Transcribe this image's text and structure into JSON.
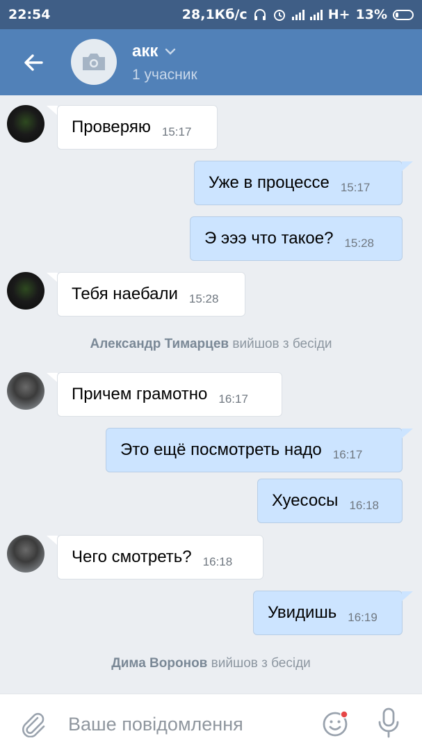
{
  "status_bar": {
    "time": "22:54",
    "net_speed": "28,1Кб/с",
    "network": "H+",
    "battery": "13%"
  },
  "header": {
    "title": "акк",
    "subtitle": "1 учасник"
  },
  "messages": [
    {
      "dir": "in",
      "avatar": "dark",
      "text": "Проверяю",
      "time": "15:17"
    },
    {
      "dir": "out",
      "text": "Уже в процессе",
      "time": "15:17"
    },
    {
      "dir": "out",
      "text": "Э эээ что такое?",
      "time": "15:28"
    },
    {
      "dir": "in",
      "avatar": "dark",
      "text": "Тебя наебали",
      "time": "15:28"
    },
    {
      "service": true,
      "name": "Александр Тимарцев",
      "action": "вийшов з бесіди"
    },
    {
      "dir": "in",
      "avatar": "gray",
      "text": "Причем грамотно",
      "time": "16:17"
    },
    {
      "dir": "out",
      "text": "Это ещё посмотреть надо",
      "time": "16:17"
    },
    {
      "dir": "out",
      "text": "Хуесосы",
      "time": "16:18"
    },
    {
      "dir": "in",
      "avatar": "gray",
      "text": "Чего смотреть?",
      "time": "16:18"
    },
    {
      "dir": "out",
      "text": "Увидишь",
      "time": "16:19"
    },
    {
      "service": true,
      "name": "Дима Воронов",
      "action": "вийшов з бесіди"
    }
  ],
  "input": {
    "placeholder": "Ваше повідомлення"
  },
  "colors": {
    "status_bar": "#3f5e86",
    "header": "#5181b8",
    "background": "#ebeef2",
    "incoming_bubble": "#ffffff",
    "outgoing_bubble": "#cce4ff",
    "notification_dot": "#e64646"
  },
  "icons": {
    "back": "arrow-left-icon",
    "chat_avatar": "camera-icon",
    "title_dropdown": "chevron-down-icon",
    "attach": "paperclip-icon",
    "emoji": "smile-icon",
    "mic": "microphone-icon"
  }
}
